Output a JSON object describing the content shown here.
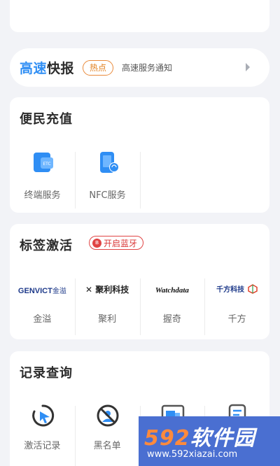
{
  "news": {
    "title_part1": "高速",
    "title_part2": "快报",
    "badge": "热点",
    "text": "高速服务通知"
  },
  "charge": {
    "title": "便民充值",
    "items": [
      {
        "label": "终端服务",
        "icon": "etc-card-icon"
      },
      {
        "label": "NFC服务",
        "icon": "nfc-phone-icon"
      }
    ]
  },
  "activate": {
    "title": "标签激活",
    "bluetooth_label": "开启蓝牙",
    "items": [
      {
        "label": "金溢",
        "logo": "GENVICT金溢"
      },
      {
        "label": "聚利",
        "logo": "聚利科技"
      },
      {
        "label": "握奇",
        "logo": "Watchdata"
      },
      {
        "label": "千方",
        "logo": "千方科技"
      }
    ]
  },
  "records": {
    "title": "记录查询",
    "items": [
      {
        "label": "激活记录"
      },
      {
        "label": "黑名单"
      },
      {
        "label": ""
      },
      {
        "label": ""
      }
    ]
  },
  "watermark": {
    "brand_num": "592",
    "brand_text": "软件园",
    "url": "www.592xiazai.com"
  },
  "colors": {
    "accent_blue": "#2f8ef4",
    "hot_orange": "#e2801f",
    "bt_red": "#e04444"
  }
}
